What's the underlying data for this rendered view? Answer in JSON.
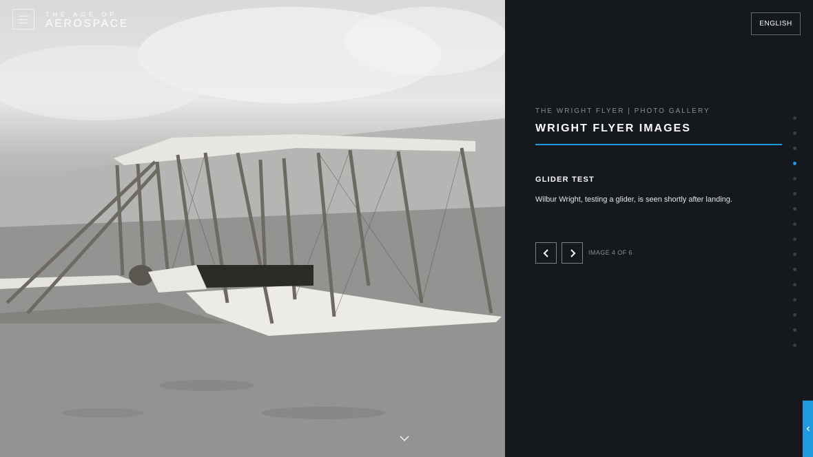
{
  "header": {
    "logo_small": "THE AGE OF",
    "logo_big": "AEROSPACE",
    "menu_icon": "hamburger-icon",
    "language_button": "ENGLISH"
  },
  "photo": {
    "subject": "photo-glider",
    "scroll_icon": "chevron-down-icon"
  },
  "gallery": {
    "eyebrow": "THE WRIGHT FLYER | PHOTO GALLERY",
    "title": "WRIGHT FLYER IMAGES",
    "image_title": "GLIDER TEST",
    "image_description": "Wilbur Wright, testing a glider, is seen shortly after landing.",
    "counter": "IMAGE 4 OF 6",
    "prev_icon": "chevron-left-icon",
    "next_icon": "chevron-right-icon"
  },
  "section_nav": {
    "total": 16,
    "active_index": 3
  },
  "side_tab": {
    "icon": "chevron-left-icon"
  },
  "colors": {
    "accent": "#1e9ae0",
    "panel_bg": "#15181c",
    "muted_text": "#8b8f94"
  }
}
